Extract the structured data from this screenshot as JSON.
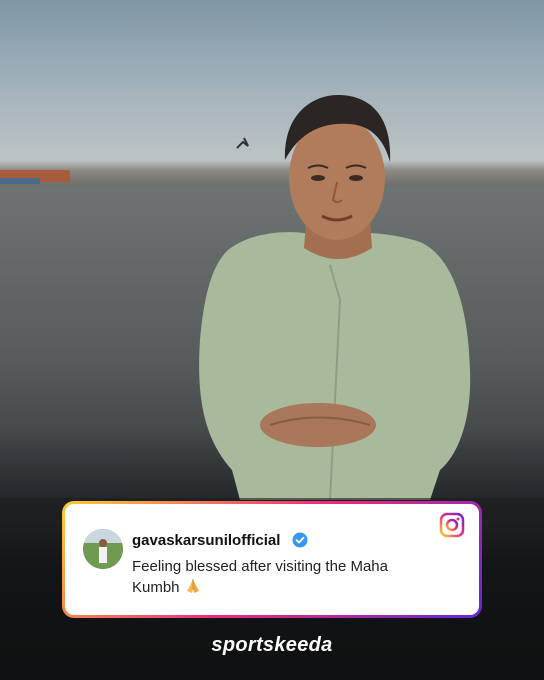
{
  "post": {
    "username": "gavaskarsunilofficial",
    "caption": "Feeling blessed after visiting the Maha Kumbh",
    "emoji_icon": "folded-hands-icon"
  },
  "branding": {
    "logo_text": "sportskeeda"
  },
  "colors": {
    "card_background": "#ffffff",
    "verified_blue": "#3897f0",
    "instagram_gradient": [
      "#f9ce34",
      "#ee2a7b",
      "#6228d7"
    ]
  }
}
